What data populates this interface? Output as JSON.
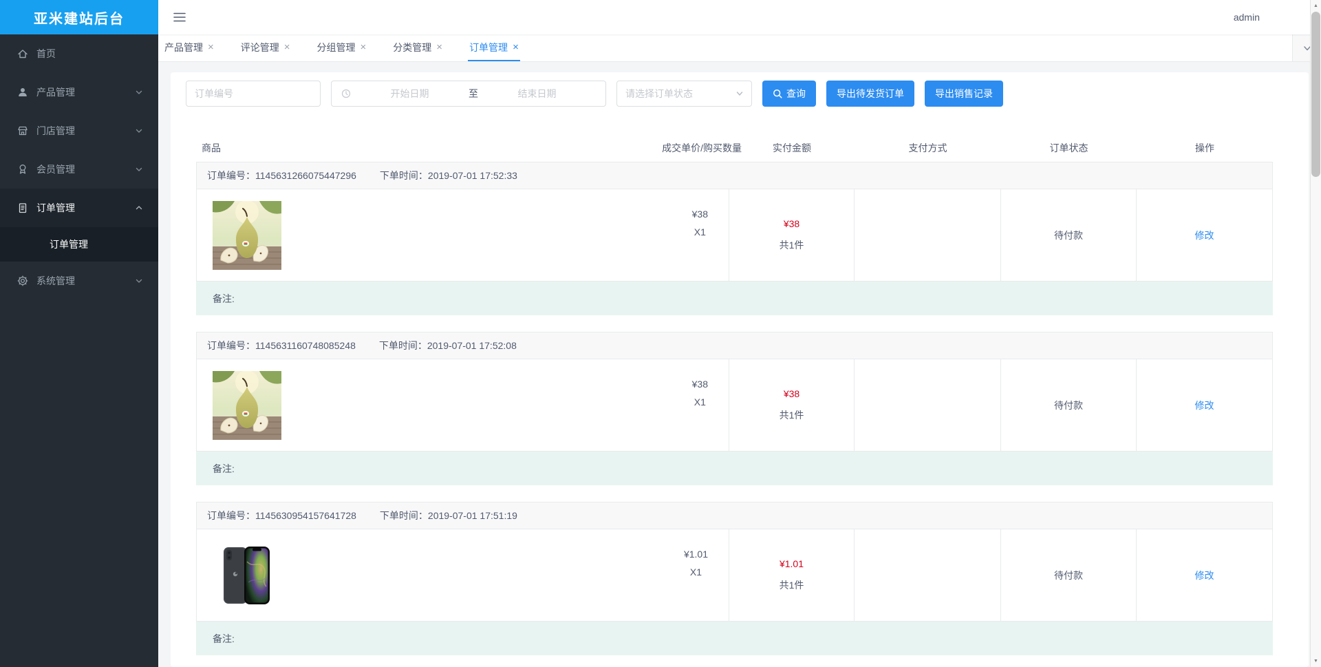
{
  "app": {
    "title": "亚米建站后台",
    "user": "admin"
  },
  "colors": {
    "primary": "#2d8cf0",
    "logo_blue": "#18a0f0",
    "price_red": "#d0021b",
    "remark_bg": "#e8f4f1",
    "sidebar_bg": "#252c34",
    "border": "#e8eaec",
    "order_head_bg": "#f8f8f9"
  },
  "icons": {
    "close": "×",
    "scroll_up": "▲",
    "scroll_down": "▼"
  },
  "sidebar": {
    "items": [
      {
        "label": "首页"
      },
      {
        "label": "产品管理"
      },
      {
        "label": "门店管理"
      },
      {
        "label": "会员管理"
      },
      {
        "label": "订单管理"
      },
      {
        "label": "系统管理"
      }
    ],
    "order_submenu": {
      "label": "订单管理"
    }
  },
  "tabs": {
    "items": [
      {
        "label": "产品管理"
      },
      {
        "label": "评论管理"
      },
      {
        "label": "分组管理"
      },
      {
        "label": "分类管理"
      },
      {
        "label": "订单管理"
      }
    ]
  },
  "filters": {
    "order_no_placeholder": "订单编号",
    "start_date_placeholder": "开始日期",
    "date_separator": "至",
    "end_date_placeholder": "结束日期",
    "status_placeholder": "请选择订单状态",
    "search_label": "查询",
    "export_pending_label": "导出待发货订单",
    "export_sales_label": "导出销售记录"
  },
  "orders_table": {
    "headers": {
      "product": "商品",
      "unit": "成交单价/购买数量",
      "paid": "实付金额",
      "payment": "支付方式",
      "status": "订单状态",
      "action": "操作"
    },
    "order_no_label": "订单编号：",
    "order_time_label": "下单时间：",
    "remark_label": "备注:",
    "orders": [
      {
        "no": "1145631266075447296",
        "time": "2019-07-01 17:52:33",
        "image": "pear-product-photo",
        "unit_price": "¥38",
        "quantity": "X1",
        "paid_amount": "¥38",
        "paid_quantity": "共1件",
        "payment": "",
        "status": "待付款",
        "action": "修改"
      },
      {
        "no": "1145631160748085248",
        "time": "2019-07-01 17:52:08",
        "image": "pear-product-photo",
        "unit_price": "¥38",
        "quantity": "X1",
        "paid_amount": "¥38",
        "paid_quantity": "共1件",
        "payment": "",
        "status": "待付款",
        "action": "修改"
      },
      {
        "no": "1145630954157641728",
        "time": "2019-07-01 17:51:19",
        "image": "iphone-product-photo",
        "unit_price": "¥1.01",
        "quantity": "X1",
        "paid_amount": "¥1.01",
        "paid_quantity": "共1件",
        "payment": "",
        "status": "待付款",
        "action": "修改"
      }
    ]
  }
}
